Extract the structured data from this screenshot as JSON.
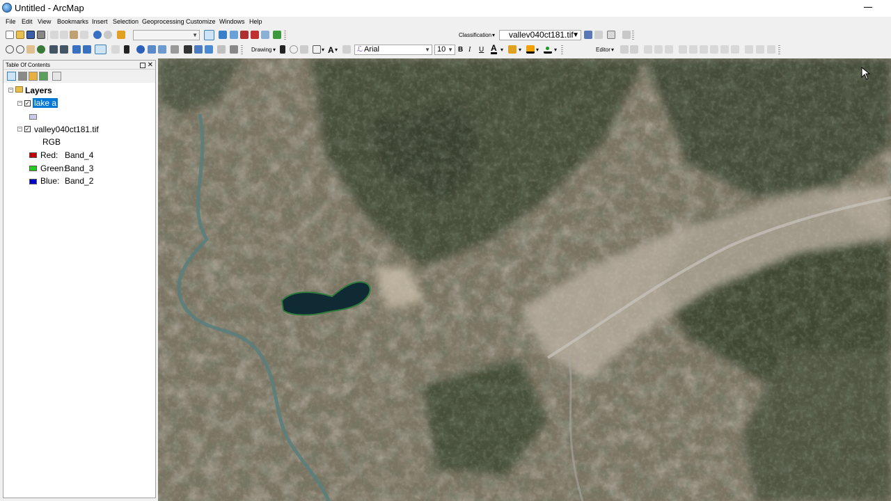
{
  "window": {
    "title": "Untitled - ArcMap"
  },
  "menu": {
    "items": [
      "File",
      "Edit",
      "View",
      "Bookmarks",
      "Insert",
      "Selection",
      "Geoprocessing",
      "Customize",
      "Windows",
      "Help"
    ]
  },
  "toolbar1": {
    "classification_label": "Classification",
    "classification_layer": "vallev040ct181.tif"
  },
  "toolbar2": {
    "drawing_label": "Drawing",
    "font_name": "Arial",
    "font_size": "10",
    "bold": "B",
    "italic": "I",
    "underline": "U",
    "font_color_glyph": "A",
    "editor_label": "Editor"
  },
  "toc": {
    "title": "Table Of Contents",
    "root_label": "Layers",
    "layers": [
      {
        "name": "lake a",
        "checked": true,
        "selected": true
      },
      {
        "name": "valley040ct181.tif",
        "checked": true,
        "selected": false,
        "render": "RGB",
        "bands": [
          {
            "label": "Red:",
            "band": "Band_4",
            "color": "#c00000"
          },
          {
            "label": "Green:",
            "band": "Band_3",
            "color": "#22cc22"
          },
          {
            "label": "Blue:",
            "band": "Band_2",
            "color": "#0000cc"
          }
        ]
      }
    ]
  },
  "colors": {
    "selection": "#0078d7",
    "lake_symbol": "#c8c8e8",
    "lake_water": "#0f2a33",
    "river": "#5b7e7c"
  }
}
